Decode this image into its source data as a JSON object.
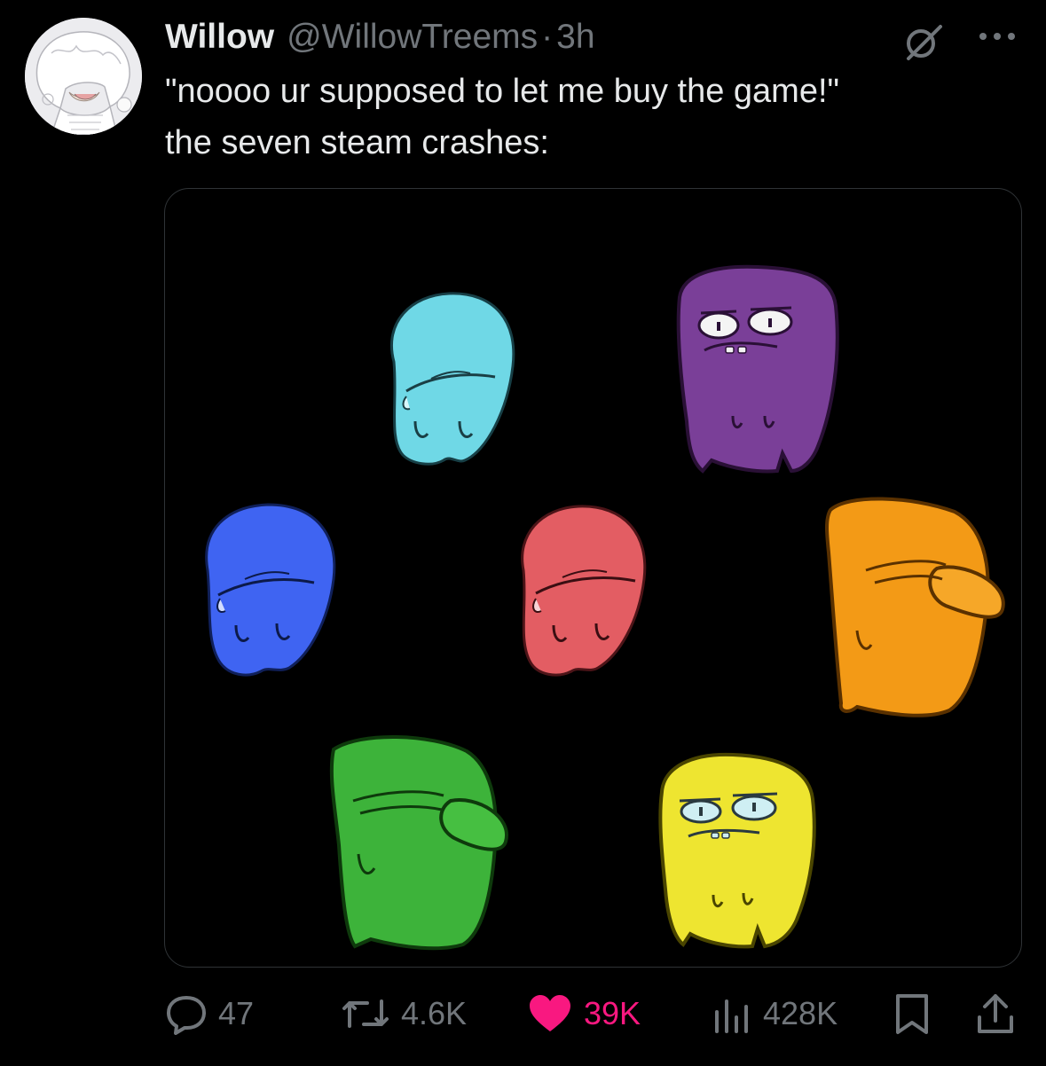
{
  "tweet": {
    "display_name": "Willow",
    "handle": "@WillowTreems",
    "separator": "·",
    "time": "3h",
    "text_lines": [
      "\"noooo ur supposed to let me buy the game!\"",
      "the seven steam crashes:"
    ]
  },
  "icons": {
    "grok": "grok-icon",
    "more": "more-icon",
    "reply": "reply-icon",
    "retweet": "retweet-icon",
    "like": "heart-icon",
    "views": "views-icon",
    "bookmark": "bookmark-icon",
    "share": "share-icon"
  },
  "actions": {
    "replies": "47",
    "retweets": "4.6K",
    "likes": "39K",
    "views": "428K"
  },
  "colors": {
    "background": "#000000",
    "text": "#e7e9ea",
    "muted": "#71767b",
    "like": "#f91880",
    "creature_cyan": "#6fd8e6",
    "creature_purple": "#7a3f98",
    "creature_blue": "#3f64f2",
    "creature_red": "#e35d63",
    "creature_orange": "#f39a16",
    "creature_green": "#3db33a",
    "creature_yellow": "#eee530"
  }
}
